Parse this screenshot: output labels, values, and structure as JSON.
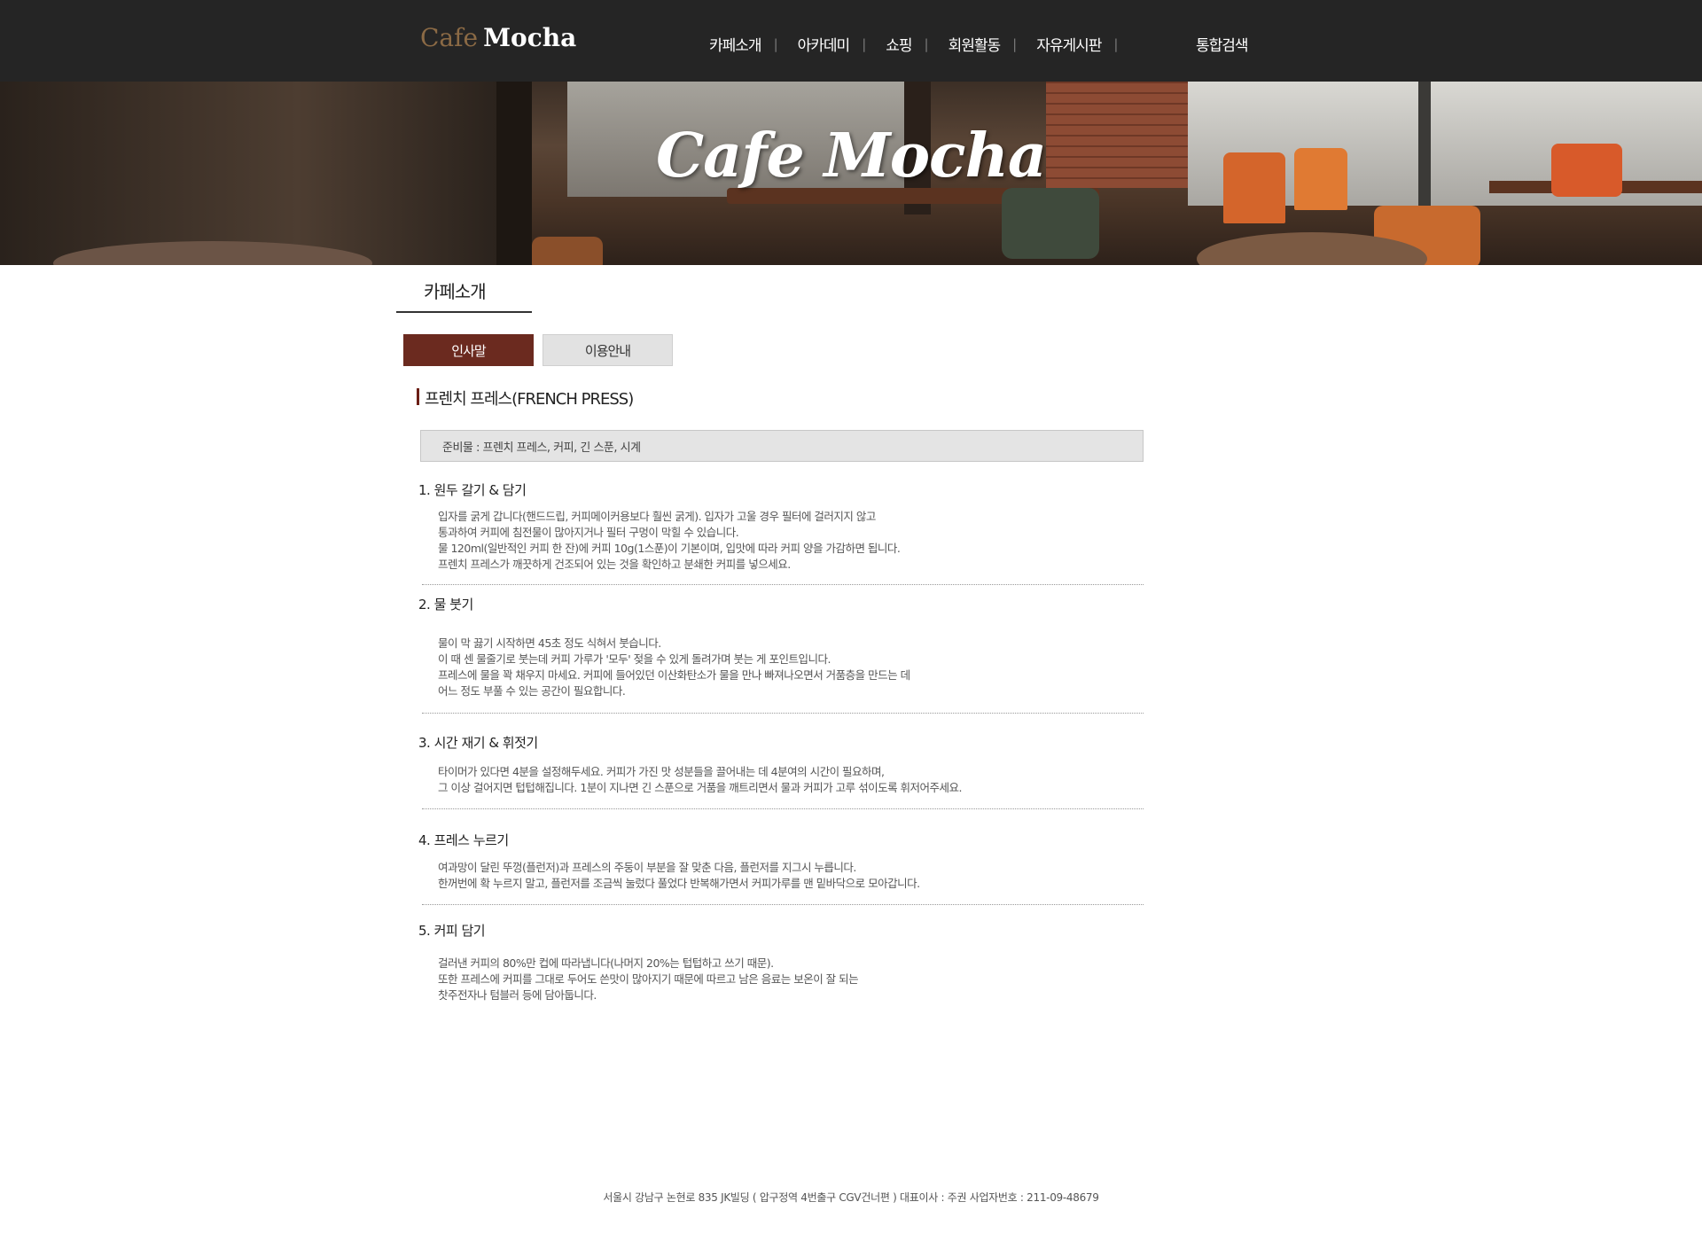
{
  "header": {
    "logo_word1": "Cafe",
    "logo_word2": "Mocha",
    "nav": [
      "카페소개",
      "아카데미",
      "쇼핑",
      "회원활동",
      "자유게시판"
    ],
    "nav_separator": "|",
    "search_label": "통합검색"
  },
  "banner": {
    "title": "Cafe Mocha"
  },
  "section": {
    "title": "카페소개",
    "tabs": [
      "인사말",
      "이용안내"
    ],
    "active_tab": "인사말"
  },
  "article": {
    "title": "프렌치 프레스(FRENCH PRESS)",
    "prep": "준비물 : 프렌치 프레스, 커피, 긴 스푼, 시계",
    "steps": [
      {
        "heading": "1. 원두 갈기 & 담기",
        "lines": [
          "입자를 굵게 갑니다(핸드드립, 커피메이커용보다 훨씬 굵게). 입자가 고울 경우 필터에 걸러지지 않고",
          "통과하여 커피에 침전물이 많아지거나 필터 구멍이 막힐 수 있습니다.",
          "물 120ml(일반적인 커피 한 잔)에 커피 10g(1스푼)이 기본이며, 입맛에 따라 커피 양을 가감하면 됩니다.",
          "프렌치 프레스가 깨끗하게 건조되어 있는 것을 확인하고 분쇄한 커피를 넣으세요."
        ]
      },
      {
        "heading": "2. 물 붓기",
        "lines": [
          "물이 막 끓기 시작하면 45초 정도 식혀서 붓습니다.",
          "이 때 센 물줄기로 붓는데 커피 가루가 '모두' 젖을 수 있게 돌려가며 붓는 게 포인트입니다.",
          "프레스에 물을 꽉 채우지 마세요. 커피에 들어있던 이산화탄소가 물을 만나 빠져나오면서 거품층을 만드는 데",
          "어느 정도 부풀 수 있는 공간이 필요합니다."
        ]
      },
      {
        "heading": "3. 시간 재기 & 휘젓기",
        "lines": [
          "타이머가 있다면 4분을 설정해두세요. 커피가 가진 맛 성분들을 끌어내는 데 4분여의 시간이 필요하며,",
          "그 이상 걸어지면 텁텁해집니다. 1분이 지나면 긴 스푼으로 거품을 깨트리면서 물과 커피가 고루 섞이도록 휘저어주세요."
        ]
      },
      {
        "heading": "4. 프레스 누르기",
        "lines": [
          "여과망이 달린 뚜껑(플런저)과 프레스의 주둥이 부분을 잘 맞춘 다음, 플런저를 지그시 누릅니다.",
          "한꺼번에 확 누르지 말고, 플런저를 조금씩 눌렀다 풀었다 반복해가면서 커피가루를 맨 밑바닥으로 모아갑니다."
        ]
      },
      {
        "heading": "5. 커피 담기",
        "lines": [
          "걸러낸 커피의 80%만 컵에 따라냅니다(나머지 20%는 텁텁하고 쓰기 때문).",
          "또한 프레스에 커피를 그대로 두어도 쓴맛이 많아지기 때문에 따르고 남은 음료는 보온이 잘 되는",
          "찻주전자나 텀블러 등에 담아둡니다."
        ]
      }
    ]
  },
  "footer": {
    "text": "서울시 강남구 논현로 835 JK빌딩 ( 압구정역 4번출구 CGV건너편 )  대표이사 : 주권  사업자번호 : 211-09-48679"
  },
  "colors": {
    "header_bg": "#252525",
    "tab_active_bg": "#6b2a1f",
    "accent_bar": "#6b1f15",
    "logo_cafe": "#8b6a45"
  }
}
